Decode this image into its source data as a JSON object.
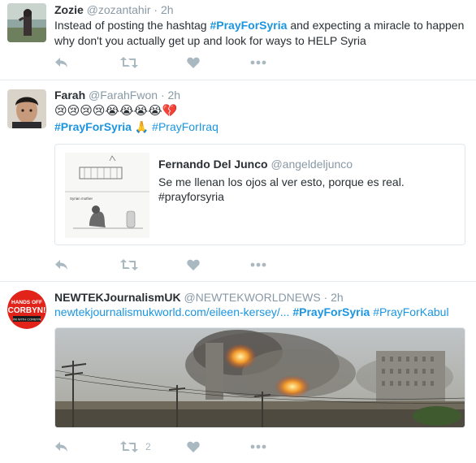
{
  "tweets": [
    {
      "name": "Zozie",
      "handle": "@zozantahir",
      "sep": "·",
      "time": "2h",
      "text_before": "Instead of posting the hashtag ",
      "hashtag": "#PrayForSyria",
      "text_after": " and expecting a miracle to happen why don't you actually get up and look for ways to HELP Syria",
      "retweet_count": "",
      "like_count": ""
    },
    {
      "name": "Farah",
      "handle": "@FarahFwon",
      "sep": "·",
      "time": "2h",
      "emoji_line": "😢😢😢😢😭😭😭😭💔",
      "hashtag1": "#PrayForSyria",
      "pray_emoji": "🙏",
      "hashtag2": "#PrayForIraq",
      "quoted": {
        "name": "Fernando Del Junco",
        "handle": "@angeldeljunco",
        "text": "Se me llenan los ojos al ver esto, porque es real.",
        "hashtag": "#prayforsyria",
        "image_caption": "Syrian mother"
      },
      "retweet_count": "",
      "like_count": ""
    },
    {
      "name": "NEWTEKJournalismUK",
      "handle": "@NEWTEKWORLDNEWS",
      "sep": "·",
      "time": "2h",
      "link": "newtekjournalismukworld.com/eileen-kersey/...",
      "hashtag1": "#PrayForSyria",
      "hashtag2": "#PrayForKabul",
      "avatar_text_top": "HANDS OFF",
      "avatar_text_main": "CORBYN!",
      "avatar_text_bottom": "I'M WITH CORBYN",
      "retweet_count": "2",
      "like_count": ""
    }
  ],
  "colors": {
    "link": "#1b95e0",
    "muted": "#8899a6",
    "action": "#aab8c2",
    "border": "#e6ecf0"
  }
}
